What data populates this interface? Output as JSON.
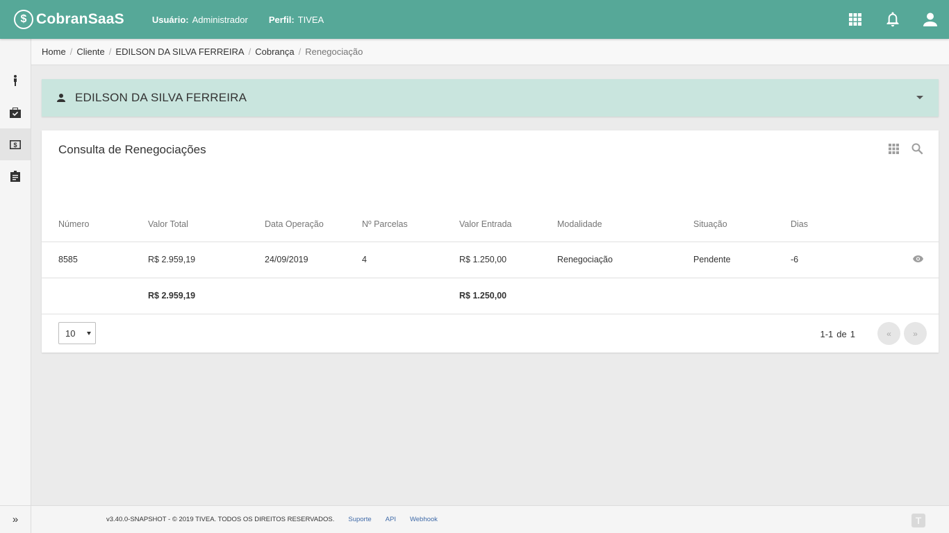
{
  "header": {
    "logo_mark": "$",
    "logo_text": "CobranSaaS",
    "user_label": "Usuário:",
    "user_value": "Administrador",
    "profile_label": "Perfil:",
    "profile_value": "TIVEA",
    "icons": [
      "apps-grid-icon",
      "bell-icon",
      "user-icon"
    ],
    "color": "#56a898"
  },
  "sidebar": {
    "items": [
      {
        "icon": "person-walk-icon",
        "active": false
      },
      {
        "icon": "briefcase-check-icon",
        "active": false
      },
      {
        "icon": "money-icon",
        "active": true
      },
      {
        "icon": "clipboard-icon",
        "active": false
      }
    ],
    "expand_label": "»"
  },
  "breadcrumb": {
    "items": [
      "Home",
      "Cliente",
      "EDILSON DA SILVA FERREIRA",
      "Cobrança",
      "Renegociação"
    ],
    "separator": "/"
  },
  "client": {
    "name": "EDILSON DA SILVA FERREIRA",
    "icon": "person-icon"
  },
  "card": {
    "title": "Consulta de Renegociações",
    "tools": [
      "columns-grid-icon",
      "search-icon"
    ],
    "columns": [
      "Número",
      "Valor Total",
      "Data Operação",
      "Nº Parcelas",
      "Valor Entrada",
      "Modalidade",
      "Situação",
      "Dias"
    ],
    "rows": [
      {
        "numero": "8585",
        "valor_total": "R$ 2.959,19",
        "data_operacao": "24/09/2019",
        "parcelas": "4",
        "valor_entrada": "R$ 1.250,00",
        "modalidade": "Renegociação",
        "situacao": "Pendente",
        "dias": "-6"
      }
    ],
    "totals": {
      "valor_total": "R$ 2.959,19",
      "valor_entrada": "R$ 1.250,00"
    },
    "page_size": "10",
    "page_range": "1-1",
    "page_of": "de",
    "page_total": "1",
    "prev_label": "«",
    "next_label": "»"
  },
  "footer": {
    "copyright": "v3.40.0-SNAPSHOT - © 2019 TIVEA. TODOS OS DIREITOS RESERVADOS.",
    "links": [
      "Suporte",
      "API",
      "Webhook"
    ],
    "logo_mark": "T"
  }
}
